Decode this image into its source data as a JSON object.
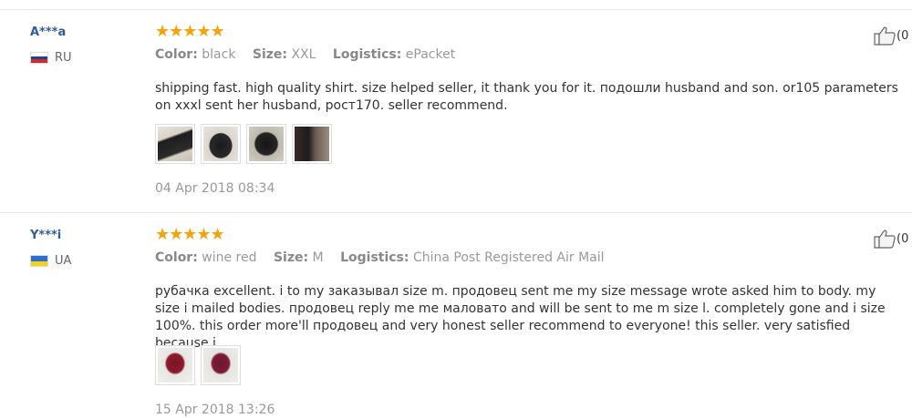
{
  "reviews": [
    {
      "user": "A***a",
      "country": "RU",
      "stars": "★★★★★",
      "attributes": {
        "color_label": "Color:",
        "color": "black",
        "size_label": "Size:",
        "size": "XXL",
        "logistics_label": "Logistics:",
        "logistics": "ePacket"
      },
      "text": "shipping fast. high quality shirt. size helped seller, it thank you for it. подошли husband and son. or105 parameters on xxxl sent her husband, рост170. seller recommend.",
      "photo_count": 4,
      "date": "04 Apr 2018 08:34",
      "helpful_count": "(0"
    },
    {
      "user": "Y***i",
      "country": "UA",
      "stars": "★★★★★",
      "attributes": {
        "color_label": "Color:",
        "color": "wine red",
        "size_label": "Size:",
        "size": "M",
        "logistics_label": "Logistics:",
        "logistics": "China Post Registered Air Mail"
      },
      "text": "рубачка excellent. i to my заказывал size m. продовец sent me my size message wrote asked him to body. my size i mailed bodies. продовец reply me me маловато and will be sent to me m size l. completely gone and i size 100%. this order more'll продовец and very honest seller recommend to everyone! this seller. very satisfied because i",
      "photo_count": 2,
      "date": "15 Apr 2018 13:26",
      "helpful_count": "(0"
    }
  ],
  "colors": {
    "username": "#2f5c9e",
    "stars": "#f5a30a",
    "muted": "#999999"
  },
  "icons": [
    "thumbs-up-icon",
    "flag-ru-icon",
    "flag-ua-icon",
    "star-icon"
  ]
}
